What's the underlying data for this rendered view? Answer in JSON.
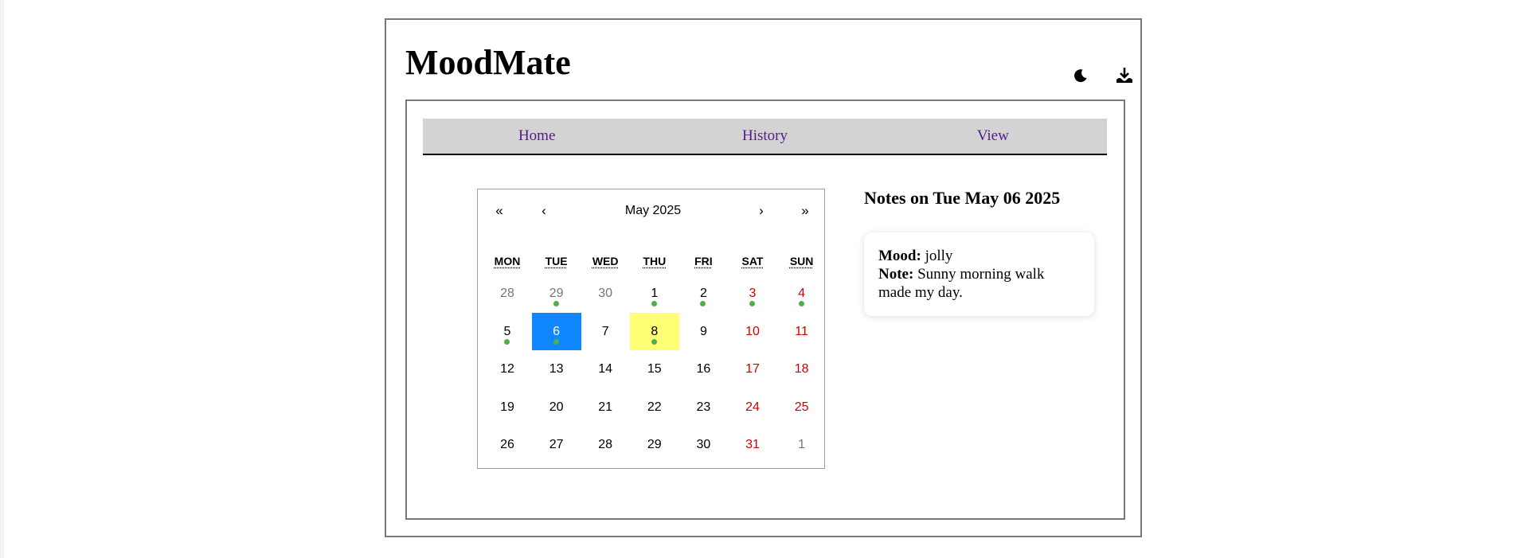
{
  "app": {
    "title": "MoodMate"
  },
  "header": {
    "theme_icon": "moon-icon",
    "download_icon": "download-icon"
  },
  "nav": {
    "items": [
      {
        "label": "Home"
      },
      {
        "label": "History"
      },
      {
        "label": "View"
      }
    ]
  },
  "calendar": {
    "prev2": "«",
    "prev": "‹",
    "month_label": "May 2025",
    "next": "›",
    "next2": "»",
    "weekdays": [
      "MON",
      "TUE",
      "WED",
      "THU",
      "FRI",
      "SAT",
      "SUN"
    ],
    "days": [
      {
        "n": "28",
        "other": true,
        "weekend": false,
        "dot": false
      },
      {
        "n": "29",
        "other": true,
        "weekend": false,
        "dot": true
      },
      {
        "n": "30",
        "other": true,
        "weekend": false,
        "dot": false
      },
      {
        "n": "1",
        "other": false,
        "weekend": false,
        "dot": true
      },
      {
        "n": "2",
        "other": false,
        "weekend": false,
        "dot": true
      },
      {
        "n": "3",
        "other": false,
        "weekend": true,
        "dot": true
      },
      {
        "n": "4",
        "other": false,
        "weekend": true,
        "dot": true
      },
      {
        "n": "5",
        "other": false,
        "weekend": false,
        "dot": true
      },
      {
        "n": "6",
        "other": false,
        "weekend": false,
        "dot": true,
        "active": true
      },
      {
        "n": "7",
        "other": false,
        "weekend": false,
        "dot": false
      },
      {
        "n": "8",
        "other": false,
        "weekend": false,
        "dot": true,
        "today": true
      },
      {
        "n": "9",
        "other": false,
        "weekend": false,
        "dot": false
      },
      {
        "n": "10",
        "other": false,
        "weekend": true,
        "dot": false
      },
      {
        "n": "11",
        "other": false,
        "weekend": true,
        "dot": false
      },
      {
        "n": "12",
        "other": false,
        "weekend": false,
        "dot": false
      },
      {
        "n": "13",
        "other": false,
        "weekend": false,
        "dot": false
      },
      {
        "n": "14",
        "other": false,
        "weekend": false,
        "dot": false
      },
      {
        "n": "15",
        "other": false,
        "weekend": false,
        "dot": false
      },
      {
        "n": "16",
        "other": false,
        "weekend": false,
        "dot": false
      },
      {
        "n": "17",
        "other": false,
        "weekend": true,
        "dot": false
      },
      {
        "n": "18",
        "other": false,
        "weekend": true,
        "dot": false
      },
      {
        "n": "19",
        "other": false,
        "weekend": false,
        "dot": false
      },
      {
        "n": "20",
        "other": false,
        "weekend": false,
        "dot": false
      },
      {
        "n": "21",
        "other": false,
        "weekend": false,
        "dot": false
      },
      {
        "n": "22",
        "other": false,
        "weekend": false,
        "dot": false
      },
      {
        "n": "23",
        "other": false,
        "weekend": false,
        "dot": false
      },
      {
        "n": "24",
        "other": false,
        "weekend": true,
        "dot": false
      },
      {
        "n": "25",
        "other": false,
        "weekend": true,
        "dot": false
      },
      {
        "n": "26",
        "other": false,
        "weekend": false,
        "dot": false
      },
      {
        "n": "27",
        "other": false,
        "weekend": false,
        "dot": false
      },
      {
        "n": "28",
        "other": false,
        "weekend": false,
        "dot": false
      },
      {
        "n": "29",
        "other": false,
        "weekend": false,
        "dot": false
      },
      {
        "n": "30",
        "other": false,
        "weekend": false,
        "dot": false
      },
      {
        "n": "31",
        "other": false,
        "weekend": true,
        "dot": false
      },
      {
        "n": "1",
        "other": true,
        "weekend": true,
        "dot": false
      }
    ]
  },
  "notes": {
    "title": "Notes on Tue May 06 2025",
    "mood_label": "Mood:",
    "mood_value": "jolly",
    "note_label": "Note:",
    "note_value": "Sunny morning walk made my day."
  },
  "colors": {
    "active_day": "#1087ff",
    "today_day": "#ffff76",
    "weekend": "#d10000",
    "mood_dot": "#4caf50",
    "nav_bg": "#d3d3d3",
    "nav_link": "#551a8b"
  }
}
